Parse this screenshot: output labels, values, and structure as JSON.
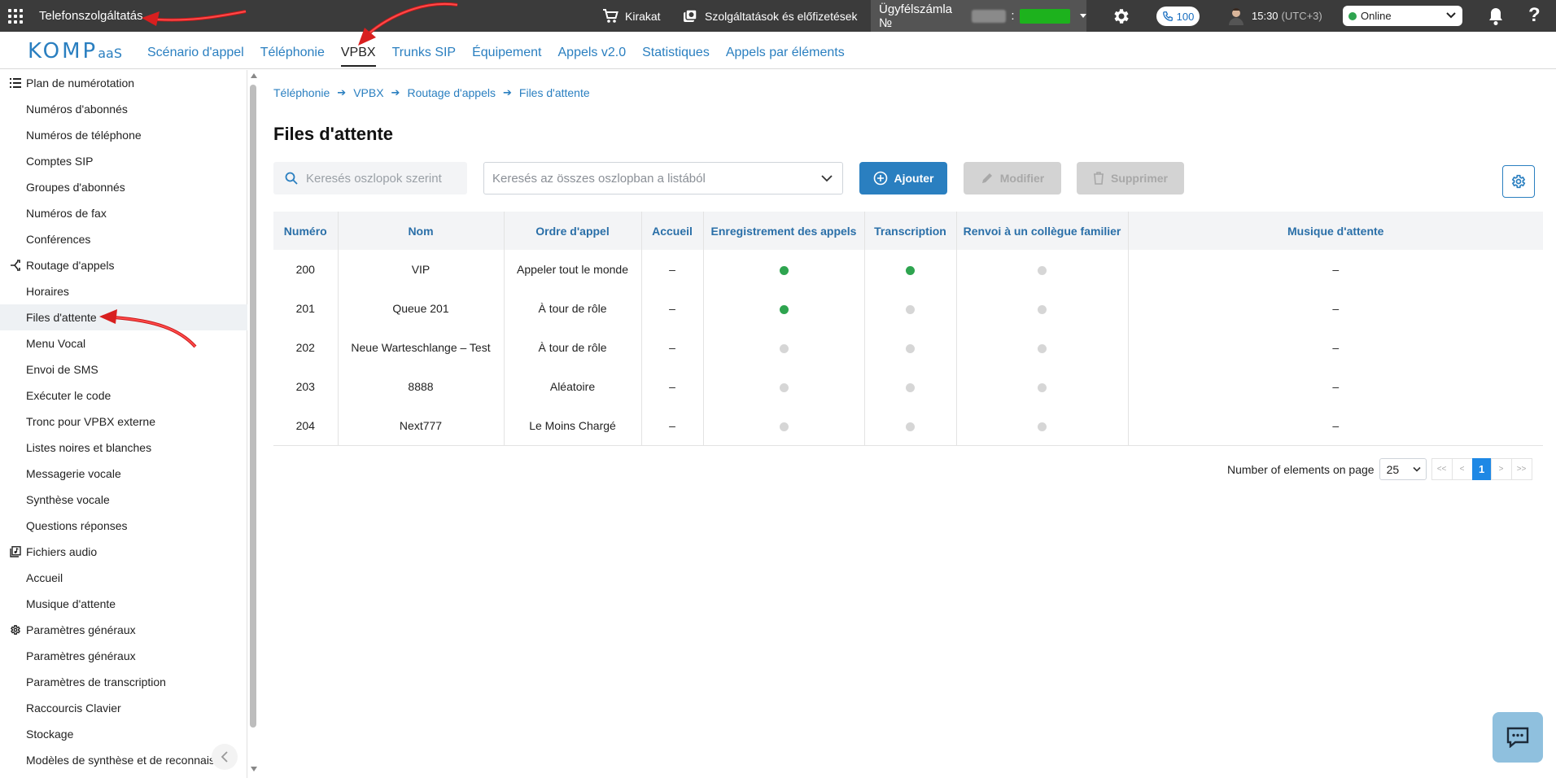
{
  "topbar": {
    "service": "Telefonszolgáltatás",
    "shop": "Kirakat",
    "subscriptions": "Szolgáltatások és előfizetések",
    "account_label": "Ügyfélszámla №",
    "calls_count": "100",
    "time": "15:30",
    "timezone": "(UTC+3)",
    "status": "Online"
  },
  "logo": {
    "text": "KOMP",
    "suffix": "aaS"
  },
  "nav": {
    "tabs": [
      "Scénario d'appel",
      "Téléphonie",
      "VPBX",
      "Trunks SIP",
      "Équipement",
      "Appels v2.0",
      "Statistiques",
      "Appels par éléments"
    ],
    "active": "VPBX"
  },
  "sidebar": {
    "items": [
      {
        "label": "Plan de numérotation",
        "type": "group",
        "icon": "list-icon"
      },
      {
        "label": "Numéros d'abonnés",
        "type": "sub"
      },
      {
        "label": "Numéros de téléphone",
        "type": "sub"
      },
      {
        "label": "Comptes SIP",
        "type": "sub"
      },
      {
        "label": "Groupes d'abonnés",
        "type": "sub"
      },
      {
        "label": "Numéros de fax",
        "type": "sub"
      },
      {
        "label": "Conférences",
        "type": "sub"
      },
      {
        "label": "Routage d'appels",
        "type": "group",
        "icon": "routing-icon"
      },
      {
        "label": "Horaires",
        "type": "sub"
      },
      {
        "label": "Files d'attente",
        "type": "sub",
        "active": true
      },
      {
        "label": "Menu Vocal",
        "type": "sub"
      },
      {
        "label": "Envoi de SMS",
        "type": "sub"
      },
      {
        "label": "Exécuter le code",
        "type": "sub"
      },
      {
        "label": "Tronc pour VPBX externe",
        "type": "sub"
      },
      {
        "label": "Listes noires et blanches",
        "type": "sub"
      },
      {
        "label": "Messagerie vocale",
        "type": "sub"
      },
      {
        "label": "Synthèse vocale",
        "type": "sub"
      },
      {
        "label": "Questions réponses",
        "type": "sub"
      },
      {
        "label": "Fichiers audio",
        "type": "group",
        "icon": "audio-files-icon"
      },
      {
        "label": "Accueil",
        "type": "sub"
      },
      {
        "label": "Musique d'attente",
        "type": "sub"
      },
      {
        "label": "Paramètres généraux",
        "type": "group",
        "icon": "gear-icon"
      },
      {
        "label": "Paramètres généraux",
        "type": "sub"
      },
      {
        "label": "Paramètres de transcription",
        "type": "sub"
      },
      {
        "label": "Raccourcis Clavier",
        "type": "sub"
      },
      {
        "label": "Stockage",
        "type": "sub"
      },
      {
        "label": "Modèles de synthèse et de reconnais",
        "type": "sub"
      }
    ]
  },
  "breadcrumb": [
    "Téléphonie",
    "VPBX",
    "Routage d'appels",
    "Files d'attente"
  ],
  "page": {
    "title": "Files d'attente"
  },
  "toolbar": {
    "search_placeholder": "Keresés oszlopok szerint",
    "select_placeholder": "Keresés az összes oszlopban a listából",
    "add_label": "Ajouter",
    "edit_label": "Modifier",
    "delete_label": "Supprimer"
  },
  "table": {
    "headers": [
      "Numéro",
      "Nom",
      "Ordre d'appel",
      "Accueil",
      "Enregistrement des appels",
      "Transcription",
      "Renvoi à un collègue familier",
      "Musique d'attente"
    ],
    "rows": [
      {
        "num": "200",
        "name": "VIP",
        "order": "Appeler tout le monde",
        "greeting": "–",
        "recording": true,
        "transcription": true,
        "forward": false,
        "music": "–"
      },
      {
        "num": "201",
        "name": "Queue 201",
        "order": "À tour de rôle",
        "greeting": "–",
        "recording": true,
        "transcription": false,
        "forward": false,
        "music": "–"
      },
      {
        "num": "202",
        "name": "Neue Warteschlange – Test",
        "order": "À tour de rôle",
        "greeting": "–",
        "recording": false,
        "transcription": false,
        "forward": false,
        "music": "–"
      },
      {
        "num": "203",
        "name": "8888",
        "order": "Aléatoire",
        "greeting": "–",
        "recording": false,
        "transcription": false,
        "forward": false,
        "music": "–"
      },
      {
        "num": "204",
        "name": "Next777",
        "order": "Le Moins Chargé",
        "greeting": "–",
        "recording": false,
        "transcription": false,
        "forward": false,
        "music": "–"
      }
    ]
  },
  "pagination": {
    "label": "Number of elements on page",
    "page_size": "25",
    "first": "<<",
    "prev": "<",
    "current": "1",
    "next": ">",
    "last": ">>"
  },
  "colors": {
    "accent": "#2a7fc0",
    "topbar": "#3b3b3b",
    "status_on": "#2ea44f",
    "status_off": "#d6d6d6",
    "annotation_arrow": "#e02020"
  }
}
